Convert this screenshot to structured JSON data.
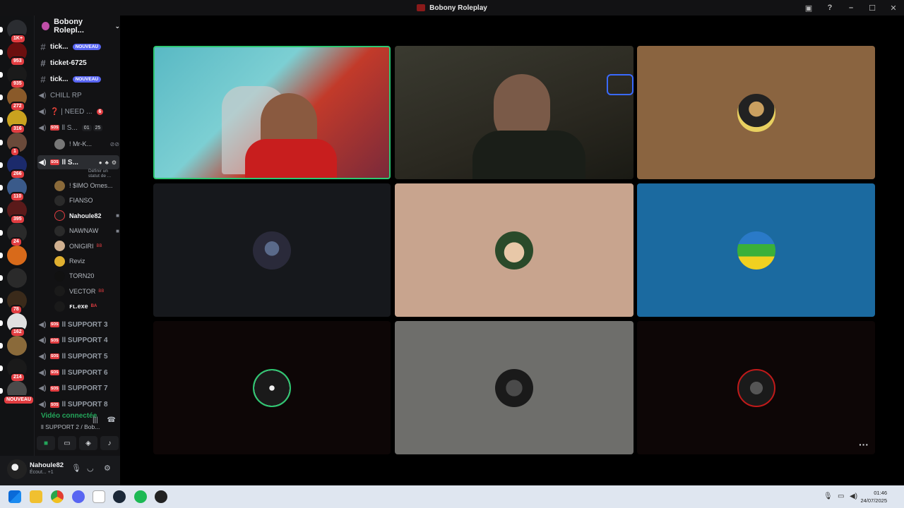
{
  "window": {
    "title": "Bobony Roleplay"
  },
  "rail": {
    "servers": [
      {
        "badge": "1K+",
        "color": "#2b2d31"
      },
      {
        "badge": "953",
        "color": "#6b0f0f"
      },
      {
        "badge": "935",
        "color": "#1a1a1a"
      },
      {
        "badge": "272",
        "color": "#8a5a2a"
      },
      {
        "badge": "316",
        "color": "#c9a21f"
      },
      {
        "badge": "1",
        "color": "#6a4a3a"
      },
      {
        "badge": "266",
        "color": "#1b2a6b"
      },
      {
        "badge": "110",
        "color": "#3a5a8a"
      },
      {
        "badge": "395",
        "color": "#5a1a1a"
      },
      {
        "badge": "24",
        "color": "#2a2a2a"
      },
      {
        "badge": "",
        "color": "#d86a1a"
      },
      {
        "badge": "",
        "color": "#2a2a2a"
      },
      {
        "badge": "78",
        "color": "#3a2a1a"
      },
      {
        "badge": "162",
        "color": "#e0e0e0"
      },
      {
        "badge": "",
        "color": "#8a6a3a"
      },
      {
        "badge": "214",
        "color": "#1a1a1a"
      },
      {
        "badge": "NOUVEAU",
        "color": "#4a4a4a"
      }
    ]
  },
  "sidebar": {
    "guild_name": "Bobony Rolepl...",
    "channels": [
      {
        "name": "tick...",
        "tag": "NOUVEAU"
      },
      {
        "name": "ticket-6725"
      },
      {
        "name": "tick...",
        "tag": "NOUVEAU"
      },
      {
        "name": "CHILL RP"
      },
      {
        "name": "❓ | NEED ...",
        "count": "6"
      },
      {
        "name": "ll S...",
        "c1": "01",
        "c2": "25"
      }
    ],
    "member_mrk": "! Mr-K...",
    "selected_channel": "ll S...",
    "status_prompt": "Définir un statut de ...",
    "members": [
      {
        "name": "! $IMO Ornes...",
        "color": "#8a6a3a"
      },
      {
        "name": "FIANSO",
        "color": "#2a2a2a"
      },
      {
        "name": "Nahoule82",
        "color": "#1a1a1a",
        "white": true,
        "cam": true
      },
      {
        "name": "NAWNAW",
        "color": "#2a2a2a",
        "cam": true
      },
      {
        "name": "ONIGIRI",
        "color": "#d0b090",
        "extra": "BB"
      },
      {
        "name": "Reviz",
        "color": "#e0b030"
      },
      {
        "name": "TORN20",
        "color": "#111"
      },
      {
        "name": "VECTOR",
        "color": "#1a1a1a",
        "extra": "BB"
      },
      {
        "name": "ꜰʟ.exe",
        "color": "#1a1a1a",
        "extra": "BA",
        "white": true
      }
    ],
    "support_channels": [
      "ll SUPPORT 3",
      "ll SUPPORT 4",
      "ll SUPPORT 5",
      "ll SUPPORT 6",
      "ll SUPPORT 7",
      "ll SUPPORT 8"
    ]
  },
  "voice": {
    "status": "Vidéo connectée",
    "channel": "ll SUPPORT 2 / Bob..."
  },
  "user": {
    "name": "Nahoule82",
    "status": "Écout...",
    "extra": "+1"
  },
  "colors": {
    "tile_brown": "#8a6440",
    "tile_dark": "#16181c",
    "tile_peach": "#c8a48e",
    "tile_blue": "#1b6aa0",
    "tile_black": "#0d0606",
    "tile_gray": "#6e6e6b",
    "speaking_border": "#2dc771"
  },
  "taskbar": {
    "time": "01:46",
    "date": "24/07/2025"
  }
}
